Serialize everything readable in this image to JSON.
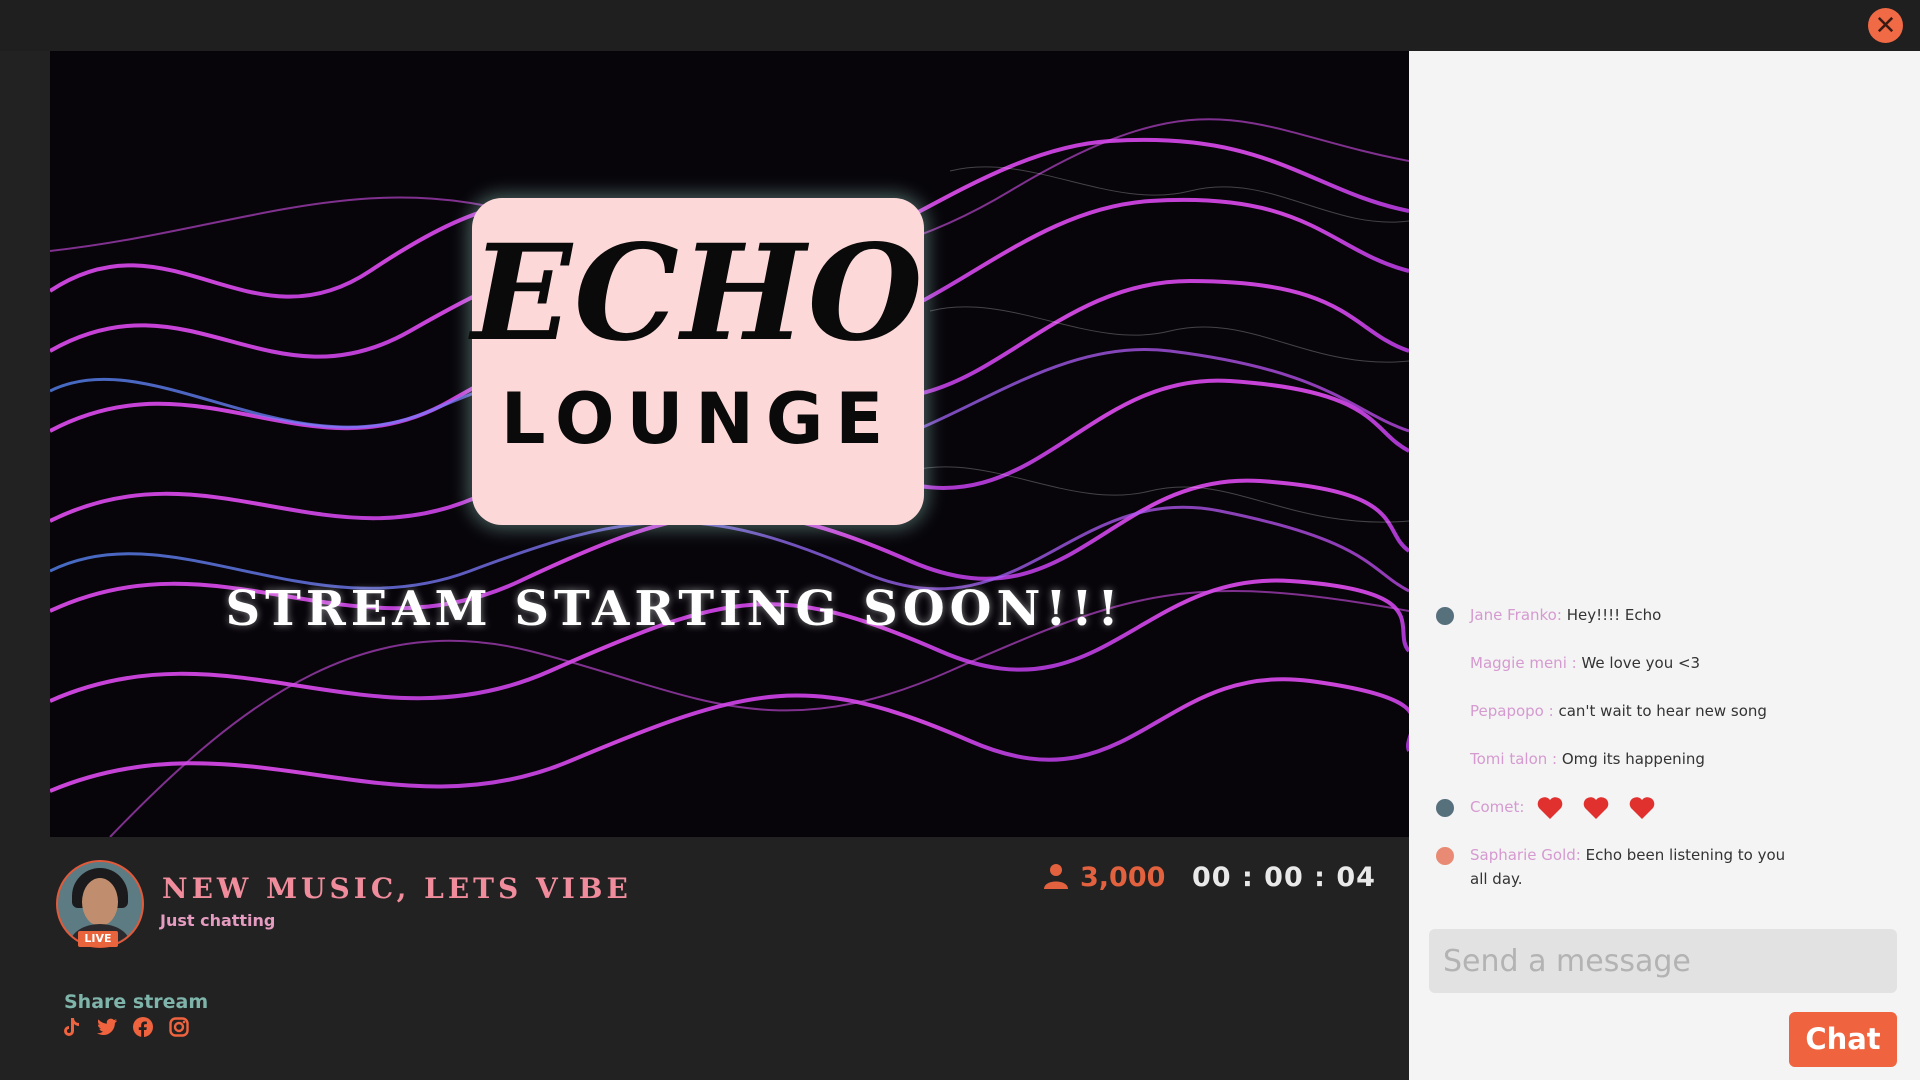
{
  "close_icon": "close-icon",
  "video": {
    "logo_line1": "ECHO",
    "logo_line2": "LOUNGE",
    "overlay_text": "STREAM STARTING SOON!!!"
  },
  "stream": {
    "title": "NEW MUSIC, LETS VIBE",
    "category": "Just chatting",
    "live_badge": "LIVE",
    "viewers": "3,000",
    "timer": "00 : 00 : 04"
  },
  "share": {
    "label": "Share stream",
    "icons": [
      "tiktok-icon",
      "twitter-icon",
      "facebook-icon",
      "instagram-icon"
    ]
  },
  "chat": {
    "messages": [
      {
        "user": "Jane Franko:",
        "text": "Hey!!!! Echo"
      },
      {
        "user": "Maggie meni :",
        "text": "We love you <3"
      },
      {
        "user": "Pepapopo :",
        "text": "can't wait to hear new song"
      },
      {
        "user": "Tomi talon :",
        "text": "Omg its happening"
      },
      {
        "user": "Comet:",
        "text": ""
      },
      {
        "user": "Sapharie Gold:",
        "text": "Echo been listening to you all day."
      }
    ],
    "input_placeholder": "Send a message",
    "send_label": "Chat"
  },
  "colors": {
    "accent": "#ef633f",
    "chat_username": "#d59ad0",
    "stream_title": "#f08c9c",
    "share_label": "#7fb4aa"
  }
}
